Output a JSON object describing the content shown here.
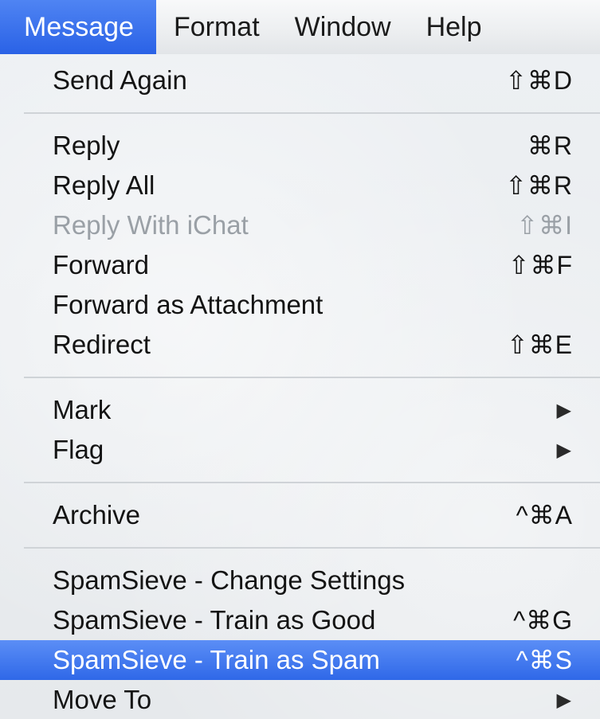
{
  "menubar": {
    "items": [
      {
        "label": "Message",
        "active": true
      },
      {
        "label": "Format",
        "active": false
      },
      {
        "label": "Window",
        "active": false
      },
      {
        "label": "Help",
        "active": false
      }
    ]
  },
  "menu": {
    "send_again": {
      "label": "Send Again",
      "shortcut": "⇧⌘D"
    },
    "reply": {
      "label": "Reply",
      "shortcut": "⌘R"
    },
    "reply_all": {
      "label": "Reply All",
      "shortcut": "⇧⌘R"
    },
    "reply_ichat": {
      "label": "Reply With iChat",
      "shortcut": "⇧⌘I",
      "enabled": false
    },
    "forward": {
      "label": "Forward",
      "shortcut": "⇧⌘F"
    },
    "forward_attachment": {
      "label": "Forward as Attachment"
    },
    "redirect": {
      "label": "Redirect",
      "shortcut": "⇧⌘E"
    },
    "mark": {
      "label": "Mark",
      "submenu_icon": "triangle-right-icon"
    },
    "flag": {
      "label": "Flag",
      "submenu_icon": "triangle-right-icon"
    },
    "archive": {
      "label": "Archive",
      "shortcut": "^⌘A"
    },
    "spamsieve_settings": {
      "label": "SpamSieve - Change Settings"
    },
    "spamsieve_good": {
      "label": "SpamSieve - Train as Good",
      "shortcut": "^⌘G"
    },
    "spamsieve_spam": {
      "label": "SpamSieve - Train as Spam",
      "shortcut": "^⌘S",
      "highlighted": true
    },
    "move_to": {
      "label": "Move To",
      "submenu_icon": "triangle-right-icon"
    }
  },
  "colors": {
    "highlight": "#3a72ee",
    "disabled_text": "#9aa0a6"
  }
}
